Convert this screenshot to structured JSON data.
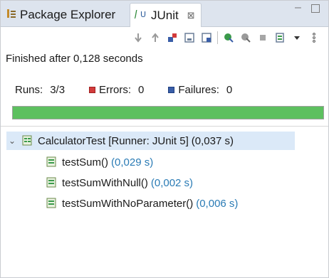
{
  "tabs": {
    "package_explorer": "Package Explorer",
    "junit": "JUnit",
    "close_glyph": "⊠"
  },
  "toolbar": {
    "buttons": [
      "next-failure-icon",
      "previous-failure-icon",
      "failures-only-icon",
      "scroll-lock-icon",
      "show-skipped-icon",
      "rerun-icon",
      "rerun-failed-first-icon",
      "stop-icon",
      "history-icon",
      "dropdown-icon",
      "view-menu-icon"
    ]
  },
  "status": "Finished after 0,128 seconds",
  "counters": {
    "runs_label": "Runs:",
    "runs_value": "3/3",
    "errors_label": "Errors:",
    "errors_value": "0",
    "failures_label": "Failures:",
    "failures_value": "0"
  },
  "progress": {
    "fraction": 1.0,
    "color": "#5dc05f"
  },
  "tree": {
    "root": {
      "label": "CalculatorTest [Runner: JUnit 5]",
      "duration": "(0,037 s)"
    },
    "children": [
      {
        "label": "testSum()",
        "duration": "(0,029 s)"
      },
      {
        "label": "testSumWithNull()",
        "duration": "(0,002 s)"
      },
      {
        "label": "testSumWithNoParameter()",
        "duration": "(0,006 s)"
      }
    ]
  },
  "colors": {
    "tab_bar": "#dde4ee",
    "selection": "#dbe9f8",
    "duration": "#2a7bb5",
    "error_red": "#d23b3b",
    "failure_blue": "#3a5ea8"
  }
}
